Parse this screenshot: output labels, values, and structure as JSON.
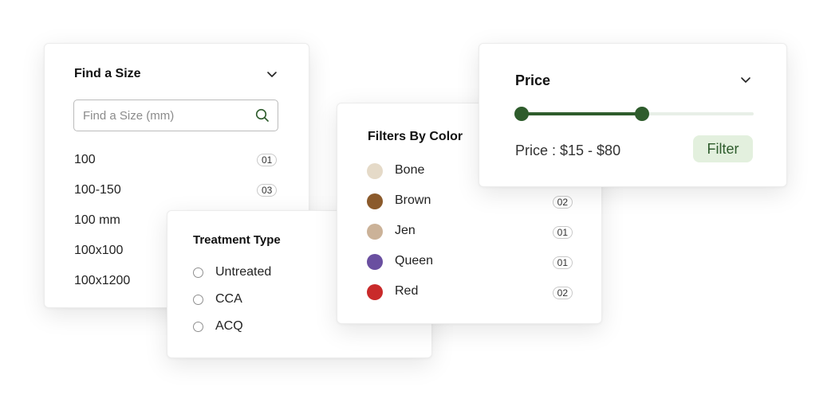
{
  "size_filter": {
    "title": "Find a Size",
    "search_placeholder": "Find a Size (mm)",
    "items": [
      {
        "label": "100",
        "count": "01"
      },
      {
        "label": "100-150",
        "count": "03"
      },
      {
        "label": "100 mm",
        "count": ""
      },
      {
        "label": "100x100",
        "count": ""
      },
      {
        "label": "100x1200",
        "count": ""
      }
    ],
    "icons": {
      "collapse": "chevron-down-icon",
      "search": "search-icon"
    },
    "colors": {
      "search_icon": "#2e5c2c"
    }
  },
  "treatment_filter": {
    "title": "Treatment Type",
    "options": [
      {
        "label": "Untreated"
      },
      {
        "label": "CCA"
      },
      {
        "label": "ACQ"
      }
    ]
  },
  "color_filter": {
    "title": "Filters By Color",
    "items": [
      {
        "label": "Bone",
        "count": "",
        "swatch": "#e5dac8"
      },
      {
        "label": "Brown",
        "count": "02",
        "swatch": "#8b5a2b"
      },
      {
        "label": "Jen",
        "count": "01",
        "swatch": "#cbb298"
      },
      {
        "label": "Queen",
        "count": "01",
        "swatch": "#6a4fa0"
      },
      {
        "label": "Red",
        "count": "02",
        "swatch": "#c92a2a"
      }
    ]
  },
  "price_filter": {
    "title": "Price",
    "range_text": "Price : $15 - $80",
    "filter_label": "Filter",
    "slider": {
      "low_fraction": 0.0,
      "high_fraction": 0.52
    },
    "icons": {
      "collapse": "chevron-down-icon"
    },
    "colors": {
      "accent": "#2e5c2c",
      "button_bg": "#e3f0de",
      "track": "#e8efe7"
    }
  }
}
